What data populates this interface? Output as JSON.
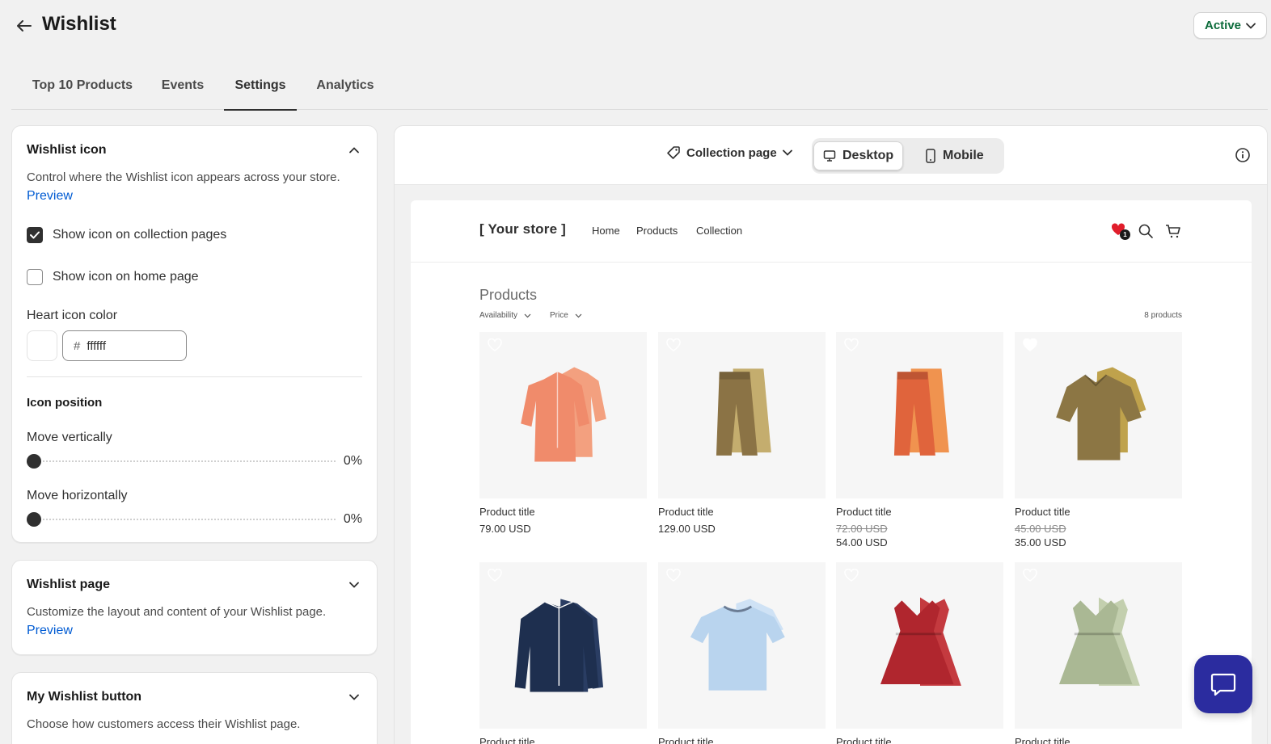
{
  "header": {
    "title": "Wishlist",
    "status_label": "Active"
  },
  "tabs": [
    {
      "label": "Top 10 Products"
    },
    {
      "label": "Events"
    },
    {
      "label": "Settings"
    },
    {
      "label": "Analytics"
    }
  ],
  "wishlist_icon": {
    "title": "Wishlist icon",
    "description": "Control where the Wishlist icon appears across your store.",
    "preview_link": "Preview",
    "show_collection_label": "Show icon on collection pages",
    "show_collection_checked": true,
    "show_home_label": "Show icon on home page",
    "show_home_checked": false,
    "color_label": "Heart icon color",
    "color_hash": "#",
    "color_value": "ffffff",
    "color_swatch": "#ffffff",
    "position_title": "Icon position",
    "vertical_label": "Move vertically",
    "vertical_value": "0%",
    "horizontal_label": "Move horizontally",
    "horizontal_value": "0%"
  },
  "wishlist_page": {
    "title": "Wishlist page",
    "description": "Customize the layout and content of your Wishlist page.",
    "preview_link": "Preview"
  },
  "my_wishlist_button": {
    "title": "My Wishlist button",
    "description": "Choose how customers access their Wishlist page."
  },
  "preview": {
    "page_select": "Collection page",
    "desktop_label": "Desktop",
    "mobile_label": "Mobile",
    "store": {
      "logo": "[ Your store ]",
      "nav": [
        "Home",
        "Products",
        "Collection"
      ],
      "wishlist_count": "1",
      "heading": "Products",
      "filters": [
        "Availability",
        "Price"
      ],
      "product_count": "8 products",
      "products": [
        {
          "title": "Product title",
          "price": "79.00 USD",
          "old_price": "",
          "icon": "shirt-icon",
          "colors": [
            "#f08b6b",
            "#f3a07f"
          ]
        },
        {
          "title": "Product title",
          "price": "129.00 USD",
          "old_price": "",
          "icon": "pants-icon",
          "colors": [
            "#8b7345",
            "#c4ad6e"
          ]
        },
        {
          "title": "Product title",
          "price": "54.00 USD",
          "old_price": "72.00 USD",
          "icon": "pants-icon",
          "colors": [
            "#e0643c",
            "#f0934f"
          ]
        },
        {
          "title": "Product title",
          "price": "35.00 USD",
          "old_price": "45.00 USD",
          "icon": "polo-icon",
          "colors": [
            "#8c7644",
            "#bfa24c"
          ]
        },
        {
          "title": "Product title",
          "price": "",
          "old_price": "",
          "icon": "jacket-icon",
          "colors": [
            "#1e2f4f",
            "#2a3d63"
          ]
        },
        {
          "title": "Product title",
          "price": "",
          "old_price": "",
          "icon": "tshirt-icon",
          "colors": [
            "#b9d4ee",
            "#cfe2f5"
          ]
        },
        {
          "title": "Product title",
          "price": "",
          "old_price": "",
          "icon": "dress-icon",
          "colors": [
            "#b0262e",
            "#c43a3f"
          ]
        },
        {
          "title": "Product title",
          "price": "",
          "old_price": "",
          "icon": "dress-icon",
          "colors": [
            "#aab894",
            "#c3cfae"
          ]
        }
      ]
    }
  },
  "colors": {
    "accent_link": "#005bd3",
    "status_green": "#0b6b3a",
    "chat_button": "#2b2c9f",
    "wishlist_heart": "#e11d2b"
  }
}
